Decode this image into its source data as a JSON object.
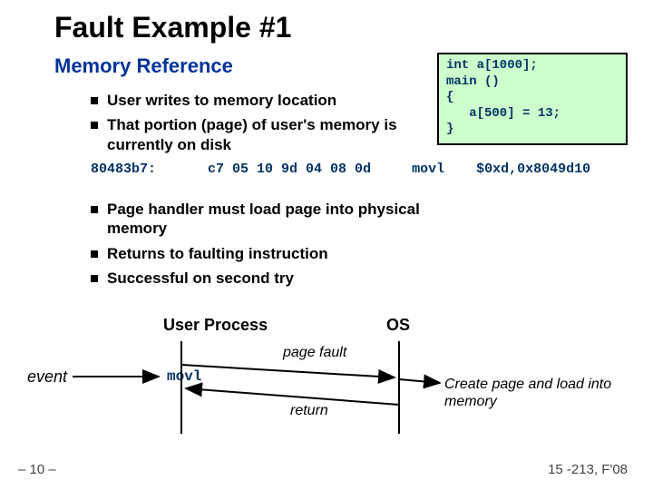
{
  "title": "Fault Example #1",
  "subtitle": "Memory Reference",
  "bullets_top": [
    "User writes to memory location",
    "That portion (page) of user's memory is currently on disk"
  ],
  "bullets_bottom": [
    "Page handler must load page into physical memory",
    "Returns to faulting instruction",
    "Successful on second try"
  ],
  "code": {
    "l1": "int a[1000];",
    "l2": "main ()",
    "l3": "{",
    "l4": "   a[500] = 13;",
    "l5": "}"
  },
  "asm": {
    "addr": "80483b7:",
    "bytes": "c7 05 10 9d 04 08 0d",
    "mnem": "movl",
    "ops": "$0xd,0x8049d10"
  },
  "labels": {
    "userproc": "User Process",
    "os": "OS",
    "event": "event",
    "movl": "movl",
    "pagefault": "page fault",
    "ret": "return",
    "ostext": "Create page and load into memory"
  },
  "footer": {
    "left": "– 10 –",
    "right": "15 -213, F'08"
  }
}
